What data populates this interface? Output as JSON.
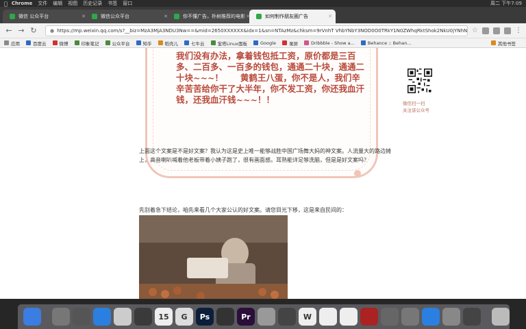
{
  "menubar": {
    "app_name": "Chrome",
    "menus": [
      "文件",
      "编辑",
      "视图",
      "历史记录",
      "书签",
      "窗口"
    ],
    "clock": "周二 下午7:09"
  },
  "tabs": [
    {
      "label": "微信 公众平台",
      "icon": "wechat-icon",
      "active": false
    },
    {
      "label": "微信公众平台",
      "icon": "wechat-icon",
      "active": false
    },
    {
      "label": "你不懂广告，朴树推荐的电影",
      "icon": "wechat-icon",
      "active": false
    },
    {
      "label": "如何制作朋友圈广告",
      "icon": "wechat-icon",
      "active": true
    }
  ],
  "address_bar": {
    "url": "https://mp.weixin.qq.com/s?__biz=MzA3MjA3NDU3Nw==&mid=2650XXXXXX&idx=1&sn=NTAzMz&chksm=9rVnhT VhbYNbY3NOD0O0TRkY1N0ZWhqRktShok2NkU0jYNhNbVfUOgwsHpxOkhPokMSt"
  },
  "bookmarks": [
    {
      "label": "应用",
      "icon": "apps-icon",
      "color": "#8a8a8a"
    },
    {
      "label": "百度云",
      "icon": "baidu-cloud-icon",
      "color": "#2c6bc5"
    },
    {
      "label": "微博",
      "icon": "weibo-icon",
      "color": "#cc3333"
    },
    {
      "label": "印象笔记",
      "icon": "evernote-icon",
      "color": "#4a8a3a"
    },
    {
      "label": "公众平台",
      "icon": "wechat-icon",
      "color": "#4a8a3a"
    },
    {
      "label": "知乎",
      "icon": "zhihu-icon",
      "color": "#2c6bc5"
    },
    {
      "label": "稻壳儿",
      "icon": "docer-icon",
      "color": "#d98a1d"
    },
    {
      "label": "七牛云",
      "icon": "qiniu-icon",
      "color": "#2c6bc5"
    },
    {
      "label": "宝塔Linux面板",
      "icon": "bt-panel-icon",
      "color": "#4a8a3a"
    },
    {
      "label": "Google",
      "icon": "google-icon",
      "color": "#2c6bc5"
    },
    {
      "label": "录屏",
      "icon": "screen-record-icon",
      "color": "#cc3333"
    },
    {
      "label": "Dribbble - Show a...",
      "icon": "dribbble-icon",
      "color": "#d0558f"
    },
    {
      "label": "Behance :: Behan...",
      "icon": "behance-icon",
      "color": "#2c6bc5"
    }
  ],
  "bookmarks_other": "其他书签",
  "poster_text": "我们没有办法，拿着钱包抵工资，原价都是三百多、二百多、一百多的钱包，通通二十块，通通二十块~~~！　　黄鹤王八蛋，你不是人，我们辛辛苦苦给你干了大半年，你不发工资，你还我血汗钱，还我血汗钱~~~！！",
  "qr_caption": [
    "微信扫一扫",
    "关注该公众号"
  ],
  "paragraph1": "上面这个文案是不是好文案？我认为这是史上唯一能够战胜中国广场舞大妈的神文案。人流量大的路边摊上，高音喇叭喊着他老板带着小姨子跑了，很有画面感。耳熟能详足够洗脑，但是是好文案吗？",
  "paragraph2": "先别着急下结论，咱先来看几个大家公认的好文案。请您目光下移，这是来自民间的：",
  "dock": [
    {
      "name": "finder-icon",
      "label": "",
      "color": "#3b7de0"
    },
    {
      "name": "launchpad-icon",
      "label": "",
      "color": "#777777"
    },
    {
      "name": "rocket-icon",
      "label": "",
      "color": "#555555"
    },
    {
      "name": "app-store-icon",
      "label": "",
      "color": "#2a7fe0"
    },
    {
      "name": "photos-icon",
      "label": "",
      "color": "#cccccc"
    },
    {
      "name": "feather-icon",
      "label": "",
      "color": "#3a3a3a"
    },
    {
      "name": "calendar-icon",
      "label": "15",
      "color": "#eeeeee"
    },
    {
      "name": "g-icon",
      "label": "G",
      "color": "#dddddd"
    },
    {
      "name": "photoshop-icon",
      "label": "Ps",
      "color": "#0c1e3a"
    },
    {
      "name": "screen-icon",
      "label": "",
      "color": "#333333"
    },
    {
      "name": "premiere-icon",
      "label": "Pr",
      "color": "#2a0f3a"
    },
    {
      "name": "preview-icon",
      "label": "",
      "color": "#999999"
    },
    {
      "name": "record-icon",
      "label": "",
      "color": "#444444"
    },
    {
      "name": "wps-icon",
      "label": "W",
      "color": "#eeeeee"
    },
    {
      "name": "qq-icon",
      "label": "",
      "color": "#eeeeee"
    },
    {
      "name": "wechat-icon",
      "label": "",
      "color": "#eeeeee"
    },
    {
      "name": "photo-booth-icon",
      "label": "",
      "color": "#aa2222"
    },
    {
      "name": "iina-icon",
      "label": "",
      "color": "#666666"
    },
    {
      "name": "app-icon",
      "label": "",
      "color": "#777777"
    },
    {
      "name": "baidu-netdisk-icon",
      "label": "",
      "color": "#2a7fe0"
    },
    {
      "name": "disk-utility-icon",
      "label": "",
      "color": "#888888"
    },
    {
      "name": "chrome-icon",
      "label": "",
      "color": "#444444"
    },
    {
      "name": "trash-icon",
      "label": "",
      "color": "#bbbbbb"
    }
  ]
}
